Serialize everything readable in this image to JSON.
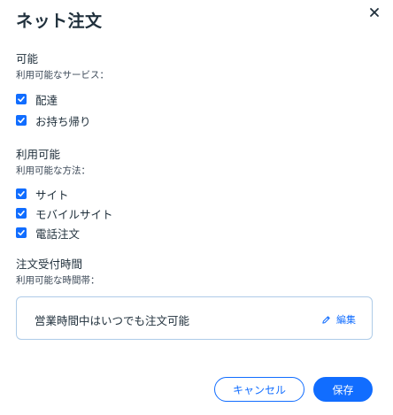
{
  "dialog": {
    "title": "ネット注文"
  },
  "availability": {
    "title": "可能",
    "subtitle": "利用可能なサービス：",
    "options": [
      {
        "label": "配達",
        "checked": true
      },
      {
        "label": "お持ち帰り",
        "checked": true
      }
    ]
  },
  "methods": {
    "title": "利用可能",
    "subtitle": "利用可能な方法：",
    "options": [
      {
        "label": "サイト",
        "checked": true
      },
      {
        "label": "モバイルサイト",
        "checked": true
      },
      {
        "label": "電話注文",
        "checked": true
      }
    ]
  },
  "hours": {
    "title": "注文受付時間",
    "subtitle": "利用可能な時間帯：",
    "value": "営業時間中はいつでも注文可能",
    "edit_label": "編集"
  },
  "footer": {
    "cancel_label": "キャンセル",
    "save_label": "保存"
  },
  "colors": {
    "accent": "#116dff",
    "text": "#20303c",
    "box_border": "#aecbe8"
  },
  "icons": {
    "close": "close-icon",
    "checkbox": "checkmark-icon",
    "edit": "pencil-icon"
  }
}
